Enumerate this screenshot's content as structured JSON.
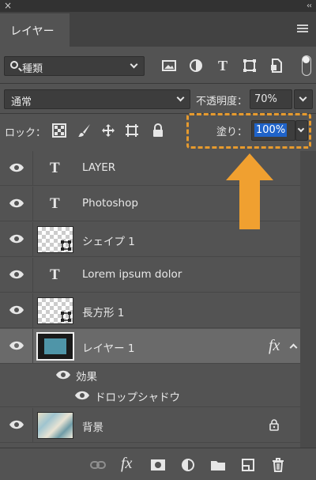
{
  "window": {
    "close_glyph": "×",
    "collapse_glyph": "‹‹"
  },
  "panel": {
    "tab_label": "レイヤー",
    "menu_icon": "hamburger-menu-icon"
  },
  "filter": {
    "kind_label": "種類",
    "icons": [
      "image-filter-icon",
      "adjustment-filter-icon",
      "type-filter-icon",
      "shape-filter-icon",
      "smart-object-filter-icon"
    ],
    "type_glyph": "T"
  },
  "blend": {
    "mode": "通常",
    "opacity_label": "不透明度：",
    "opacity_value": "70%"
  },
  "lock": {
    "label": "ロック：",
    "icons": [
      "lock-transparent-pixels-icon",
      "lock-image-pixels-icon",
      "lock-position-icon",
      "lock-artboard-icon",
      "lock-all-icon"
    ],
    "fill_label": "塗り：",
    "fill_value": "100%",
    "highlight_color": "#e69a2e"
  },
  "layers": [
    {
      "name": "LAYER",
      "kind": "text",
      "type_glyph": "T"
    },
    {
      "name": "Photoshop",
      "kind": "text",
      "type_glyph": "T"
    },
    {
      "name": "シェイプ 1",
      "kind": "shape"
    },
    {
      "name": "Lorem ipsum dolor",
      "kind": "text",
      "type_glyph": "T"
    },
    {
      "name": "長方形 1",
      "kind": "shape"
    },
    {
      "name": "レイヤー 1",
      "kind": "pixel",
      "selected": true,
      "fx_label": "fx"
    },
    {
      "name": "効果",
      "kind": "effects-group"
    },
    {
      "name": "ドロップシャドウ",
      "kind": "effect"
    },
    {
      "name": "背景",
      "kind": "background",
      "locked": true
    }
  ],
  "bottom_icons": [
    "link-layers-icon",
    "add-layer-style-icon",
    "add-mask-icon",
    "new-adjustment-layer-icon",
    "new-group-icon",
    "new-layer-icon",
    "delete-layer-icon"
  ],
  "bottom_fx_label": "fx",
  "colors": {
    "panel_bg": "#535353",
    "selected_row": "#6a6a6a",
    "selection_blue": "#1f63c9",
    "arrow_orange": "#f0a030"
  }
}
